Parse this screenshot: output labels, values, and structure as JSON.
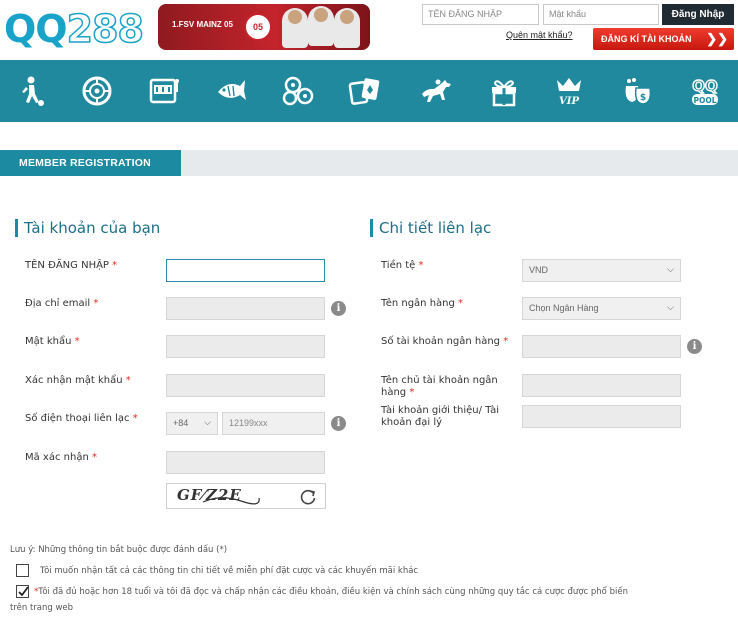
{
  "header": {
    "logo_qq": "QQ",
    "logo_num": "288",
    "banner_text": "1.FSV MAINZ 05",
    "banner_crest": "05",
    "username_placeholder": "TÊN ĐĂNG NHẬP",
    "password_placeholder": "Mật khẩu",
    "login_label": "Đăng Nhập",
    "forgot_label": "Quên mật khẩu?",
    "register_label": "ĐĂNG KÍ TÀI KHOẢN",
    "register_arrow": "❯❯"
  },
  "nav": {
    "items": [
      {
        "icon": "soccer-player-icon"
      },
      {
        "icon": "roulette-icon"
      },
      {
        "icon": "slot-machine-icon"
      },
      {
        "icon": "fish-game-icon"
      },
      {
        "icon": "lottery-balls-icon"
      },
      {
        "icon": "playing-cards-icon"
      },
      {
        "icon": "horse-racing-icon"
      },
      {
        "icon": "gift-icon"
      },
      {
        "icon": "vip-crown-icon",
        "label": "VIP"
      },
      {
        "icon": "money-bags-icon"
      },
      {
        "icon": "qq-pool-icon",
        "label": "POOL"
      }
    ]
  },
  "section": {
    "title": "MEMBER REGISTRATION"
  },
  "account": {
    "heading": "Tài khoản của bạn",
    "username_label": "TÊN ĐĂNG NHẬP",
    "email_label": "Địa chỉ email",
    "password_label": "Mật khẩu",
    "confirm_label": "Xác nhận mật khẩu",
    "phone_label": "Số điện thoại liên lạc",
    "phone_code": "+84",
    "phone_placeholder": "12199xxx",
    "captcha_label": "Mã xác nhận",
    "captcha_text": "GF⁄Z2E"
  },
  "contact": {
    "heading": "Chi tiết liên lạc",
    "currency_label": "Tiền tệ",
    "currency_value": "VND",
    "bank_label": "Tên ngân hàng",
    "bank_value": "Chọn Ngân Hàng",
    "account_no_label": "Số tài khoản ngân hàng",
    "holder_label": "Tên chủ tài khoản ngân hàng",
    "referral_label": "Tài khoản giới thiệu/ Tài khoản đại lý"
  },
  "required_mark": "*",
  "footer": {
    "note": "Lưu ý: Những thông tin bắt buộc được đánh dấu (*)",
    "promo_label": "Tôi muốn nhận tất cả các thông tin chi tiết về miễn phí đặt cược và các khuyến mãi khác",
    "terms_label_1": "Tôi đã đủ hoặc hơn 18 tuổi và tôi đã đọc và chấp nhận các điều khoản, điều kiện và chính sách cùng những quy tắc cá cược được phổ biến",
    "terms_label_2": "trên trang web"
  },
  "colors": {
    "nav_bg": "#20899e",
    "accent": "#1c8aa0",
    "register_red": "#d9231a",
    "required_red": "#e02a1d"
  }
}
